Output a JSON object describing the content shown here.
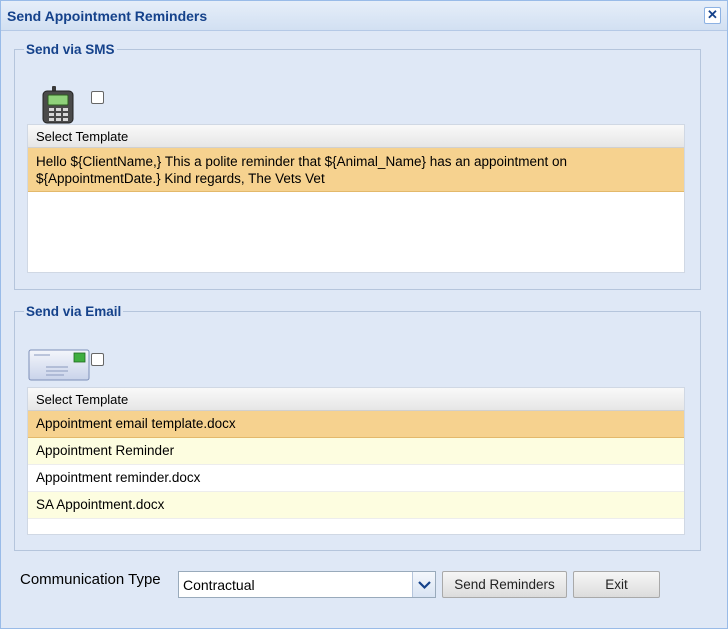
{
  "window": {
    "title": "Send Appointment Reminders",
    "close_glyph": "✕"
  },
  "sms": {
    "legend": "Send via SMS",
    "icon": "mobile-phone-icon",
    "checkbox_checked": false,
    "grid_header": "Select Template",
    "rows": [
      "Hello ${ClientName,} This a polite reminder that ${Animal_Name} has an appointment on ${AppointmentDate.} Kind regards, The Vets Vet"
    ]
  },
  "email": {
    "legend": "Send via Email",
    "icon": "envelope-icon",
    "checkbox_checked": false,
    "grid_header": "Select Template",
    "rows": [
      "Appointment email template.docx",
      "Appointment Reminder",
      "Appointment reminder.docx",
      "SA Appointment.docx"
    ]
  },
  "footer": {
    "comm_type_label": "Communication Type",
    "comm_type_value": "Contractual",
    "send_label": "Send Reminders",
    "exit_label": "Exit"
  },
  "colors": {
    "title_text": "#15428b",
    "selected_row": "#f6d28f",
    "alt_row": "#fdfde0",
    "window_bg": "#dfe8f6"
  }
}
